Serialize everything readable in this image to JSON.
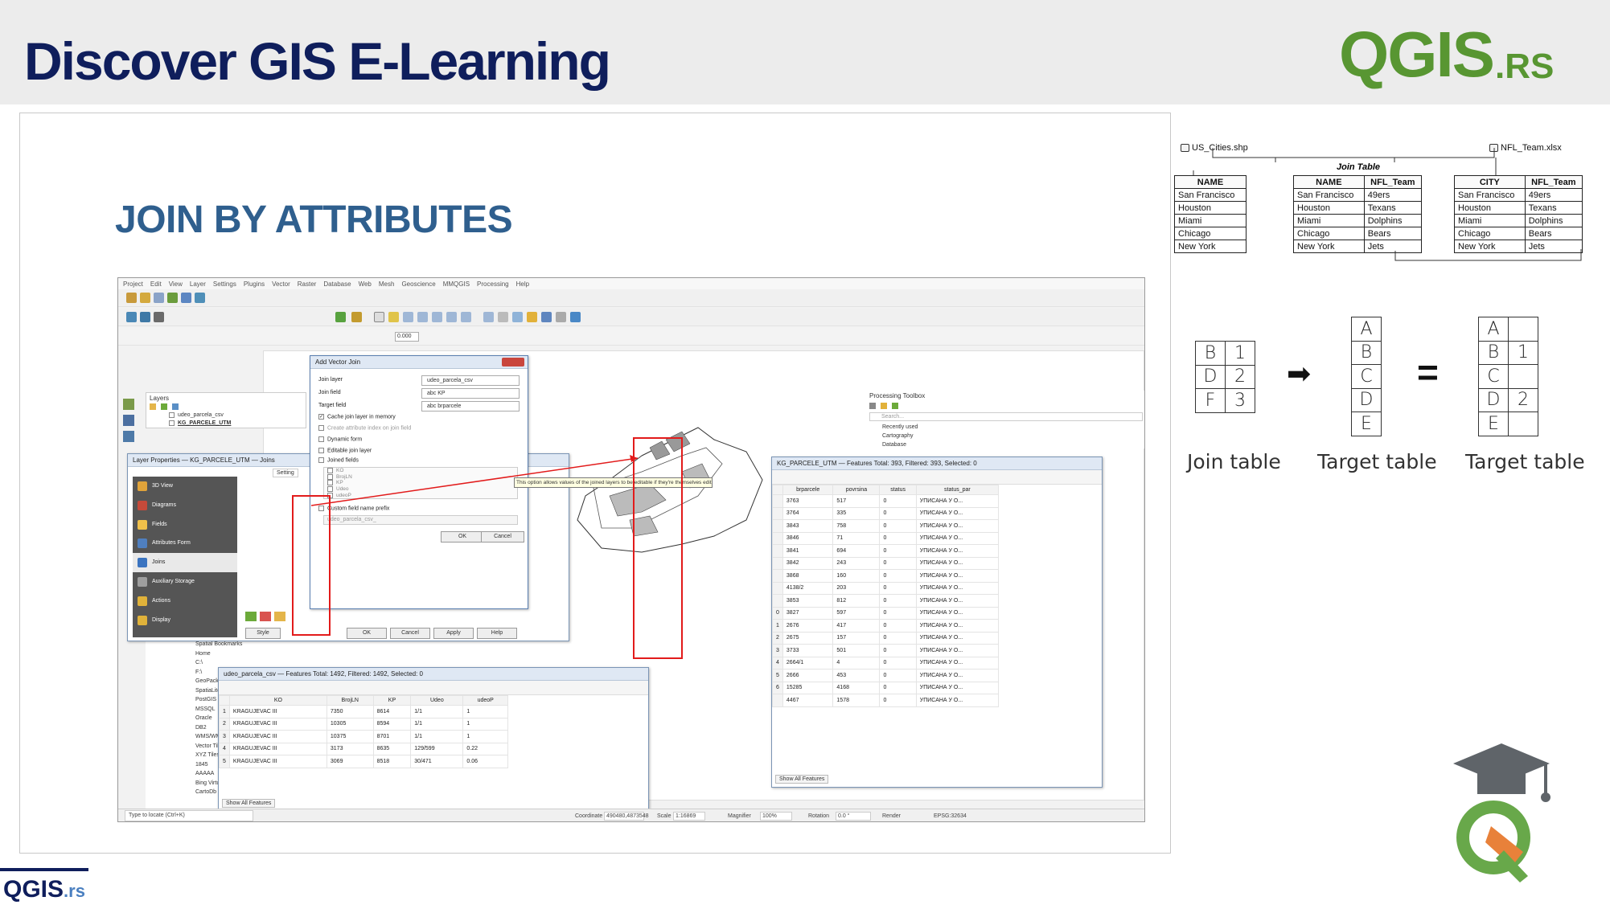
{
  "header": {
    "title": "Discover GIS E-Learning",
    "logo_main": "QGIS",
    "logo_suffix": ".RS"
  },
  "slide": {
    "heading": "JOIN BY ATTRIBUTES"
  },
  "footer": {
    "logo_main": "QGIS",
    "logo_suffix": ".rs"
  },
  "qgis": {
    "menu": [
      "Project",
      "Edit",
      "View",
      "Layer",
      "Settings",
      "Plugins",
      "Vector",
      "Raster",
      "Database",
      "Web",
      "Mesh",
      "Geoscience",
      "MMQGIS",
      "Processing",
      "Help"
    ],
    "layers_panel": {
      "title": "Layers",
      "items": [
        "udeo_parcela_csv",
        "KG_PARCELE_UTM"
      ]
    },
    "layer_properties": {
      "title": "Layer Properties — KG_PARCELE_UTM — Joins",
      "search_label": "Setting",
      "items": [
        "3D View",
        "Diagrams",
        "Fields",
        "Attributes Form",
        "Joins",
        "Auxiliary Storage",
        "Actions",
        "Display"
      ],
      "buttons": {
        "style": "Style",
        "ok": "OK",
        "cancel": "Cancel",
        "apply": "Apply",
        "help": "Help"
      }
    },
    "add_vector_join": {
      "title": "Add Vector Join",
      "join_layer_label": "Join layer",
      "join_layer_value": "udeo_parcela_csv",
      "join_field_label": "Join field",
      "join_field_value": "abc KP",
      "target_field_label": "Target field",
      "target_field_value": "abc brparcele",
      "cache_label": "Cache join layer in memory",
      "index_label": "Create attribute index on join field",
      "dynamic_label": "Dynamic form",
      "editable_label": "Editable join layer",
      "joined_fields_label": "Joined fields",
      "fields": [
        "KO",
        "BrojLN",
        "KP",
        "Udeo",
        "udeoP"
      ],
      "prefix_label": "Custom field name prefix",
      "prefix_value": "udeo_parcela_csv_",
      "ok": "OK",
      "cancel": "Cancel"
    },
    "tooltip": "This option allows values of the joined layers to be editable if they're themselves editable",
    "processing_toolbox": {
      "title": "Processing Toolbox",
      "search": "Search...",
      "items": [
        "Recently used",
        "Cartography",
        "Database"
      ]
    },
    "browser": {
      "items": [
        "Spatial Bookmarks",
        "Home",
        "C:\\",
        "F:\\",
        "GeoPackage",
        "SpatiaLite",
        "PostGIS",
        "MSSQL",
        "Oracle",
        "DB2",
        "WMS/WMTS",
        "Vector Tiles",
        "XYZ Tiles",
        "1845",
        "AAAAA",
        "Bing VirtualE",
        "CartoDb Da"
      ]
    },
    "csv_table": {
      "title": "udeo_parcela_csv — Features Total: 1492, Filtered: 1492, Selected: 0",
      "columns": [
        "",
        "KO",
        "BrojLN",
        "KP",
        "Udeo",
        "udeoP"
      ],
      "rows": [
        [
          "1",
          "KRAGUJEVAC III",
          "7350",
          "8614",
          "1/1",
          "1"
        ],
        [
          "2",
          "KRAGUJEVAC III",
          "10305",
          "8594",
          "1/1",
          "1"
        ],
        [
          "3",
          "KRAGUJEVAC III",
          "10375",
          "8701",
          "1/1",
          "1"
        ],
        [
          "4",
          "KRAGUJEVAC III",
          "3173",
          "8635",
          "129/599",
          "0.22"
        ],
        [
          "5",
          "KRAGUJEVAC III",
          "3069",
          "8518",
          "30/471",
          "0.06"
        ]
      ],
      "show_all": "Show All Features"
    },
    "utm_table": {
      "title": "KG_PARCELE_UTM — Features Total: 393, Filtered: 393, Selected: 0",
      "columns": [
        "",
        "brparcele",
        "povrsina",
        "status",
        "status_par"
      ],
      "rows": [
        [
          "",
          "3763",
          "517",
          "0",
          "УПИСАНА У О..."
        ],
        [
          "",
          "3764",
          "335",
          "0",
          "УПИСАНА У О..."
        ],
        [
          "",
          "3843",
          "758",
          "0",
          "УПИСАНА У О..."
        ],
        [
          "",
          "3846",
          "71",
          "0",
          "УПИСАНА У О..."
        ],
        [
          "",
          "3841",
          "694",
          "0",
          "УПИСАНА У О..."
        ],
        [
          "",
          "3842",
          "243",
          "0",
          "УПИСАНА У О..."
        ],
        [
          "",
          "3868",
          "160",
          "0",
          "УПИСАНА У О..."
        ],
        [
          "",
          "4138/2",
          "203",
          "0",
          "УПИСАНА У О..."
        ],
        [
          "",
          "3853",
          "812",
          "0",
          "УПИСАНА У О..."
        ],
        [
          "0",
          "3827",
          "597",
          "0",
          "УПИСАНА У О..."
        ],
        [
          "1",
          "2676",
          "417",
          "0",
          "УПИСАНА У О..."
        ],
        [
          "2",
          "2675",
          "157",
          "0",
          "УПИСАНА У О..."
        ],
        [
          "3",
          "3733",
          "501",
          "0",
          "УПИСАНА У О..."
        ],
        [
          "4",
          "2664/1",
          "4",
          "0",
          "УПИСАНА У О..."
        ],
        [
          "5",
          "2666",
          "453",
          "0",
          "УПИСАНА У О..."
        ],
        [
          "6",
          "15285",
          "4168",
          "0",
          "УПИСАНА У О..."
        ],
        [
          "",
          "4467",
          "1578",
          "0",
          "УПИСАНА У О..."
        ]
      ],
      "show_all": "Show All Features"
    },
    "statusbar": {
      "locate": "Type to locate (Ctrl+K)",
      "coordinate_label": "Coordinate",
      "coordinate": "490480,4873548",
      "scale_label": "Scale",
      "scale": "1:16869",
      "magnifier_label": "Magnifier",
      "magnifier": "100%",
      "rotation_label": "Rotation",
      "rotation": "0.0 °",
      "render": "Render",
      "crs": "EPSG:32634"
    },
    "toolbar_value": "0.000"
  },
  "join_diagram": {
    "file_left": "US_Cities.shp",
    "file_right": "NFL_Team.xlsx",
    "join_caption": "Join Table",
    "left_table": {
      "header": "NAME",
      "rows": [
        "San Francisco",
        "Houston",
        "Miami",
        "Chicago",
        "New York"
      ]
    },
    "middle_table": {
      "headers": [
        "NAME",
        "NFL_Team"
      ],
      "rows": [
        [
          "San Francisco",
          "49ers"
        ],
        [
          "Houston",
          "Texans"
        ],
        [
          "Miami",
          "Dolphins"
        ],
        [
          "Chicago",
          "Bears"
        ],
        [
          "New York",
          "Jets"
        ]
      ]
    },
    "right_table": {
      "headers": [
        "CITY",
        "NFL_Team"
      ],
      "rows": [
        [
          "San Francisco",
          "49ers"
        ],
        [
          "Houston",
          "Texans"
        ],
        [
          "Miami",
          "Dolphins"
        ],
        [
          "Chicago",
          "Bears"
        ],
        [
          "New York",
          "Jets"
        ]
      ]
    }
  },
  "schema": {
    "join_table": [
      [
        "B",
        "1"
      ],
      [
        "D",
        "2"
      ],
      [
        "F",
        "3"
      ]
    ],
    "target_table": [
      "A",
      "B",
      "C",
      "D",
      "E"
    ],
    "result_table": [
      [
        "A",
        ""
      ],
      [
        "B",
        "1"
      ],
      [
        "C",
        ""
      ],
      [
        "D",
        "2"
      ],
      [
        "E",
        ""
      ]
    ],
    "arrow": "➡",
    "equals": "=",
    "labels": [
      "Join table",
      "Target table",
      "Target table"
    ]
  },
  "colors": {
    "title": "#0f1e5c",
    "heading": "#2f5f8e",
    "qgis_green": "#589632",
    "highlight_red": "#e21b1b"
  }
}
